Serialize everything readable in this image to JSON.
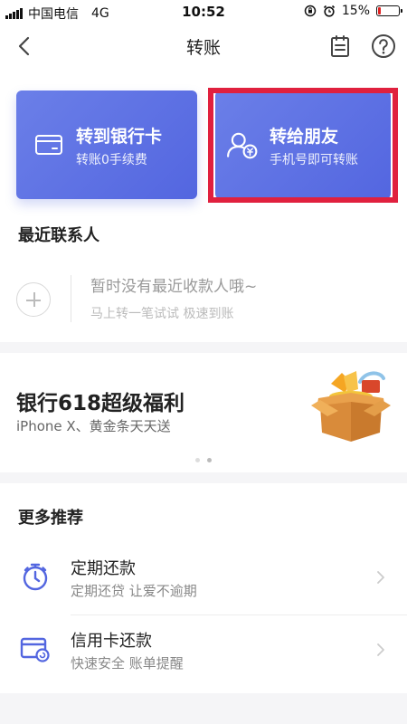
{
  "status_bar": {
    "carrier": "中国电信",
    "network": "4G",
    "time": "10:52",
    "battery_percent": "15%",
    "battery_level": 0.15,
    "battery_color": "#e02020"
  },
  "nav": {
    "title": "转账",
    "back_icon": "chevron-left-icon",
    "bill_icon": "bill-list-icon",
    "help_icon": "question-circle-icon"
  },
  "cards": {
    "bank": {
      "title": "转到银行卡",
      "subtitle": "转账0手续费",
      "icon": "bank-card-icon"
    },
    "friend": {
      "title": "转给朋友",
      "subtitle": "手机号即可转账",
      "icon": "friend-transfer-icon"
    }
  },
  "recent": {
    "title": "最近联系人",
    "empty_main": "暂时没有最近收款人哦~",
    "empty_sub": "马上转一笔试试 极速到账"
  },
  "banner": {
    "title": "银行618超级福利",
    "subtitle": "iPhone X、黄金条天天送",
    "page_count": 2,
    "active_page": 2
  },
  "more": {
    "title": "更多推荐",
    "items": [
      {
        "title": "定期还款",
        "subtitle": "定期还贷 让爱不逾期",
        "icon": "stopwatch-icon"
      },
      {
        "title": "信用卡还款",
        "subtitle": "快速安全 账单提醒",
        "icon": "credit-card-repay-icon"
      }
    ]
  },
  "colors": {
    "accent": "#5366e0",
    "highlight_border": "#e0203e"
  }
}
